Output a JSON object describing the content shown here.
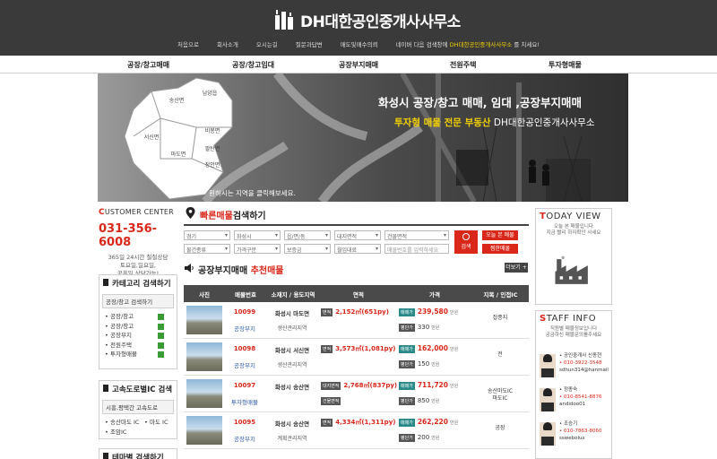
{
  "header": {
    "logo_text": "DH대한공인중개사사무소",
    "nav": [
      "처음으로",
      "회사소개",
      "오시는길",
      "질문과답변",
      "매도및매수의뢰"
    ],
    "notice_prefix": "네이버 다음 검색창에",
    "notice_highlight": "DH대한공인중개사사무소",
    "notice_suffix": "를 치세요!"
  },
  "menu": [
    "공장/창고매매",
    "공장/창고임대",
    "공장부지매매",
    "전원주택",
    "투자형매물"
  ],
  "hero": {
    "title": "화성시 공장/창고 매매, 임대 ,공장부지매매",
    "sub_hand": "투자형 매물 전문 부동산",
    "sub_rest": "DH대한공인중개사사무소",
    "click_text": "원하시는 지역을 클릭해보세요.",
    "regions": [
      "송산면",
      "남양읍",
      "서신면",
      "마도면",
      "비봉면",
      "팔탄면",
      "장안면"
    ]
  },
  "customer_center": {
    "title_first": "C",
    "title_rest": "USTOMER CENTER",
    "phone": "031-356-6008",
    "hours": [
      "365일 24시간 철철상담",
      "토요일,일요일,",
      "공휴일 상담가능!"
    ]
  },
  "category_box": {
    "title": "카테고리 검색하기",
    "selected": "공장/창고 검색하기",
    "items": [
      "공장/창고",
      "공장/창고",
      "공장부지",
      "전원주택",
      "투자형매물"
    ]
  },
  "highway_box": {
    "title": "고속도로별IC 검색",
    "selected": "시흥,평택간 고속도로",
    "items": [
      "송산마도 IC",
      "마도 IC",
      "조암IC"
    ]
  },
  "theme_box": {
    "title": "테마별 검색하기"
  },
  "quick_search": {
    "title_red": "빠른매물",
    "title_rest": "검색하기",
    "row1": [
      "경기",
      "화성시",
      "읍/면/동",
      "대지면적",
      "건물면적"
    ],
    "row2": [
      "물건종류",
      "가격구분",
      "보증금",
      "월임대료"
    ],
    "placeholder": "매물번호를 입력하세요",
    "search_label": "검색",
    "today_btn": "오늘 본 매물",
    "watch_btn": "찜한매물"
  },
  "listing": {
    "title_rest": "공장부지매매",
    "title_red": "추천매물",
    "more": "더보기 +",
    "columns": [
      "사진",
      "매물번호",
      "소재지 / 용도지역",
      "면적",
      "가격",
      "지목 / 인접IC"
    ],
    "rows": [
      {
        "no": "10099",
        "cat": "공장부지",
        "loc": "화성시 마도면",
        "zone": "생산관리지역",
        "tag1": "면적",
        "area1": "2,152㎡(651py)",
        "tag2": "",
        "area2": "",
        "ptag1": "매매가",
        "price1": "239,580",
        "ptag2": "평단가",
        "price2": "330",
        "unit": "만원",
        "near": [
          "잡종지"
        ]
      },
      {
        "no": "10098",
        "cat": "공장부지",
        "loc": "화성시 서신면",
        "zone": "생산관리지역",
        "tag1": "면적",
        "area1": "3,573㎡(1,081py)",
        "tag2": "",
        "area2": "",
        "ptag1": "매매가",
        "price1": "162,000",
        "ptag2": "평단가",
        "price2": "150",
        "unit": "만원",
        "near": [
          "전"
        ]
      },
      {
        "no": "10097",
        "cat": "투자형매물",
        "loc": "화성시 송산면",
        "zone": "",
        "tag1": "대지면적",
        "area1": "2,768㎡(837py)",
        "tag2": "건물면적",
        "area2": "",
        "ptag1": "매매가",
        "price1": "711,720",
        "ptag2": "평단가",
        "price2": "850",
        "unit": "만원",
        "near": [
          "송산마도IC",
          "마도IC"
        ]
      },
      {
        "no": "10095",
        "cat": "공장부지",
        "loc": "화성시 송산면",
        "zone": "계획관리지역",
        "tag1": "면적",
        "area1": "4,334㎡(1,311py)",
        "tag2": "",
        "area2": "",
        "ptag1": "매매가",
        "price1": "262,220",
        "ptag2": "평단가",
        "price2": "200",
        "unit": "만원",
        "near": [
          "공장"
        ]
      }
    ]
  },
  "today_view": {
    "title_first": "T",
    "title_rest": "ODAY VIEW",
    "sub": [
      "오늘 본 매물입니다",
      "지금 빨리 하자확인 사세요"
    ]
  },
  "staff": {
    "title_first": "S",
    "title_rest": "TAFF INFO",
    "sub": [
      "직원별 매물정보입니다",
      "궁금하신 매물문의를주세요"
    ],
    "people": [
      {
        "name": "• 공인중개사 신동현",
        "phone": "• 010-3922-3548",
        "mail": "sdhun314@hanmail"
      },
      {
        "name": "• 정종숙",
        "phone": "• 010-8541-8876",
        "mail": "andidoo01"
      },
      {
        "name": "• 조승기",
        "phone": "• 010-7863-8060",
        "mail": "sswebolus"
      }
    ]
  },
  "colors": {
    "accent": "#d9271a",
    "dark": "#3a3a3a",
    "green": "#3a9a36"
  }
}
